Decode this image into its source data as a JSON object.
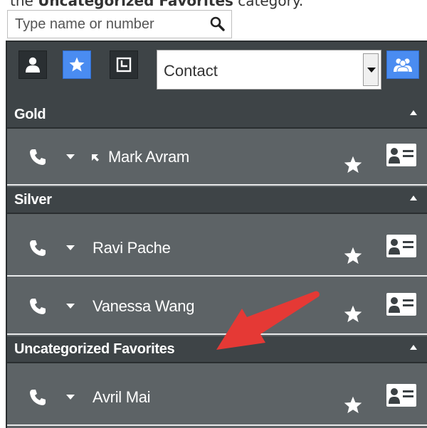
{
  "caption": {
    "prefix": "the ",
    "bold": "Uncategorized Favorites",
    "suffix": " category."
  },
  "search": {
    "placeholder": "Type name or number"
  },
  "toolbar": {
    "buttons": [
      {
        "icon": "person-icon",
        "active": false
      },
      {
        "icon": "star-icon",
        "active": true
      },
      {
        "icon": "recent-history-icon",
        "active": false
      }
    ],
    "type_select": {
      "selected": "Contact"
    },
    "group_icon": "group-contacts-icon"
  },
  "categories": [
    {
      "title": "Gold",
      "contacts": [
        {
          "name": "Mark Avram",
          "status_icon": "arrow-up-left-icon"
        }
      ]
    },
    {
      "title": "Silver",
      "contacts": [
        {
          "name": "Ravi Pache"
        },
        {
          "name": "Vanessa Wang"
        }
      ]
    },
    {
      "title": "Uncategorized Favorites",
      "contacts": [
        {
          "name": "Avril Mai"
        }
      ]
    }
  ],
  "colors": {
    "panel_bg": "#5d6366",
    "header_bg": "#3e4447",
    "accent_blue": "#4a8cf1",
    "annotation_arrow": "#e53935"
  }
}
